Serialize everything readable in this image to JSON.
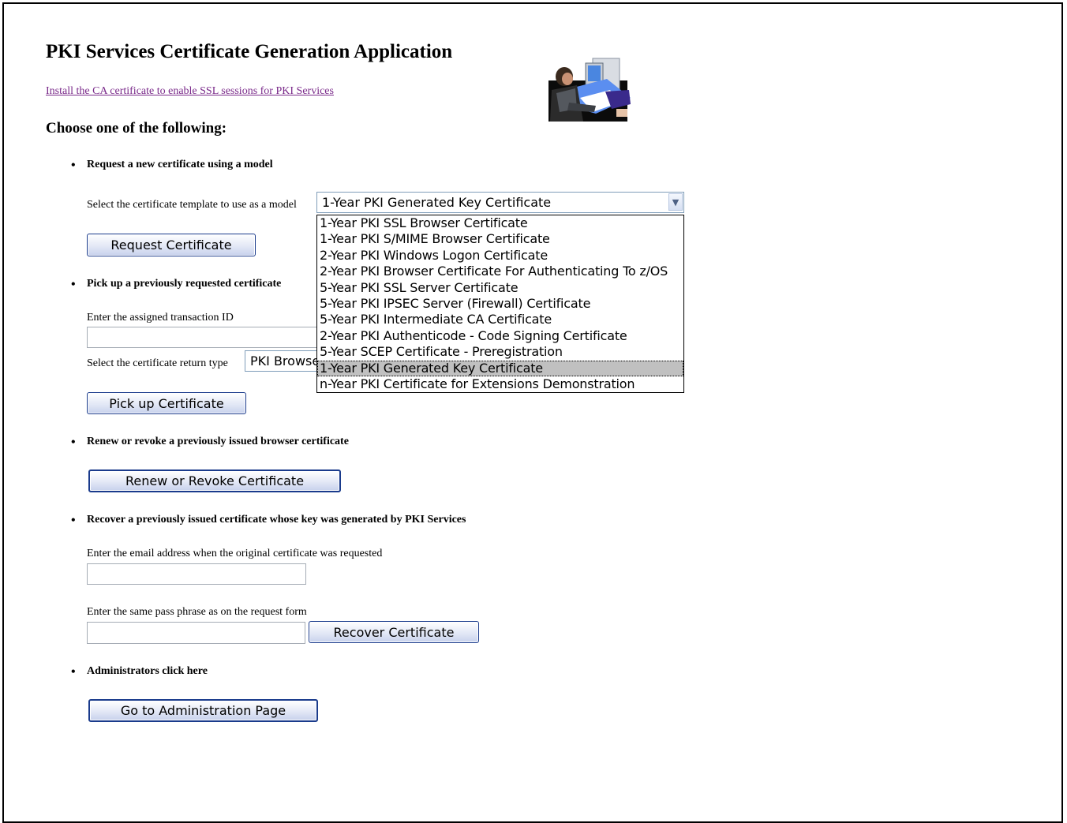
{
  "header": {
    "title": "PKI Services Certificate Generation Application",
    "ca_link": "Install the CA certificate to enable SSL sessions for PKI Services",
    "illustration_icon": "person-at-computer-icon"
  },
  "choose_label": "Choose one of the following:",
  "request": {
    "heading": "Request a new certificate using a model",
    "template_label": "Select the certificate template to use as a model",
    "selected_template": "1-Year PKI Generated Key Certificate",
    "button": "Request Certificate",
    "options": [
      "1-Year PKI SSL Browser Certificate",
      "1-Year PKI S/MIME Browser Certificate",
      "2-Year PKI Windows Logon Certificate",
      "2-Year PKI Browser Certificate For Authenticating To z/OS",
      "5-Year PKI SSL Server Certificate",
      "5-Year PKI IPSEC Server (Firewall) Certificate",
      "5-Year PKI Intermediate CA Certificate",
      "2-Year PKI Authenticode - Code Signing Certificate",
      "5-Year SCEP Certificate - Preregistration",
      "1-Year PKI Generated Key Certificate",
      "n-Year PKI Certificate for Extensions Demonstration"
    ],
    "highlighted_index": 9
  },
  "pickup": {
    "heading": "Pick up a previously requested certificate",
    "transaction_label": "Enter the assigned transaction ID",
    "transaction_value": "",
    "return_type_label": "Select the certificate return type",
    "return_type_value": "PKI Browser Certificate",
    "button": "Pick up Certificate"
  },
  "renew": {
    "heading": "Renew or revoke a previously issued browser certificate",
    "button": "Renew or Revoke Certificate"
  },
  "recover": {
    "heading": "Recover a previously issued certificate whose key was generated by PKI Services",
    "email_label": "Enter the email address when the original certificate was requested",
    "email_value": "",
    "passphrase_label": "Enter the same pass phrase as on the request form",
    "passphrase_value": "",
    "button": "Recover Certificate"
  },
  "admin": {
    "heading": "Administrators click here",
    "button": "Go to Administration Page"
  }
}
